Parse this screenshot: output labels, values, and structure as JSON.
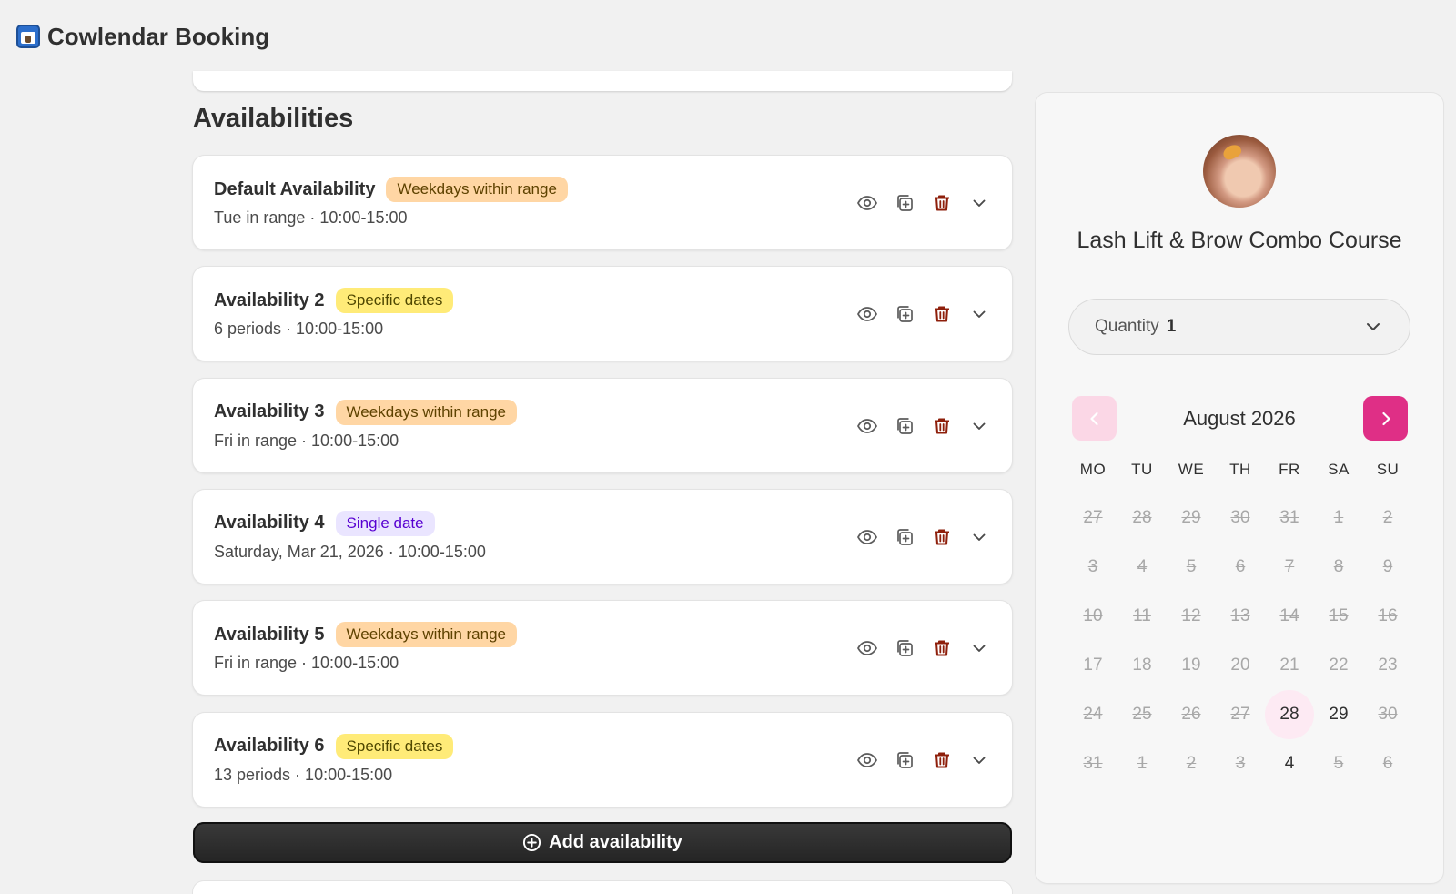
{
  "app": {
    "title": "Cowlendar Booking"
  },
  "section": {
    "title": "Availabilities"
  },
  "availabilities": [
    {
      "name": "Default Availability",
      "badge": "Weekdays within range",
      "badge_color": "orange",
      "summary": "Tue in range · 10:00-15:00"
    },
    {
      "name": "Availability 2",
      "badge": "Specific dates",
      "badge_color": "yellow",
      "summary": "6 periods · 10:00-15:00"
    },
    {
      "name": "Availability 3",
      "badge": "Weekdays within range",
      "badge_color": "orange",
      "summary": "Fri in range · 10:00-15:00"
    },
    {
      "name": "Availability 4",
      "badge": "Single date",
      "badge_color": "purple",
      "summary": "Saturday, Mar 21, 2026 · 10:00-15:00"
    },
    {
      "name": "Availability 5",
      "badge": "Weekdays within range",
      "badge_color": "orange",
      "summary": "Fri in range · 10:00-15:00"
    },
    {
      "name": "Availability 6",
      "badge": "Specific dates",
      "badge_color": "yellow",
      "summary": "13 periods · 10:00-15:00"
    }
  ],
  "add_button": {
    "label": "Add availability"
  },
  "preview": {
    "service_name": "Lash Lift & Brow Combo Course",
    "quantity_label": "Quantity",
    "quantity_value": "1",
    "month": "August 2026",
    "weekdays": [
      "MO",
      "TU",
      "WE",
      "TH",
      "FR",
      "SA",
      "SU"
    ],
    "weeks": [
      [
        "27",
        "28",
        "29",
        "30",
        "31",
        "1",
        "2"
      ],
      [
        "3",
        "4",
        "5",
        "6",
        "7",
        "8",
        "9"
      ],
      [
        "10",
        "11",
        "12",
        "13",
        "14",
        "15",
        "16"
      ],
      [
        "17",
        "18",
        "19",
        "20",
        "21",
        "22",
        "23"
      ],
      [
        "24",
        "25",
        "26",
        "27",
        "28",
        "29",
        "30"
      ],
      [
        "31",
        "1",
        "2",
        "3",
        "4",
        "5",
        "6"
      ]
    ],
    "available_days": [
      "4-4",
      "4-5",
      "5-4"
    ],
    "highlighted_day": "4-4",
    "accent_color": "#df2f86"
  },
  "icons": {
    "view": "eye-icon",
    "duplicate": "duplicate-icon",
    "delete": "trash-icon",
    "expand": "chevron-down-icon"
  }
}
